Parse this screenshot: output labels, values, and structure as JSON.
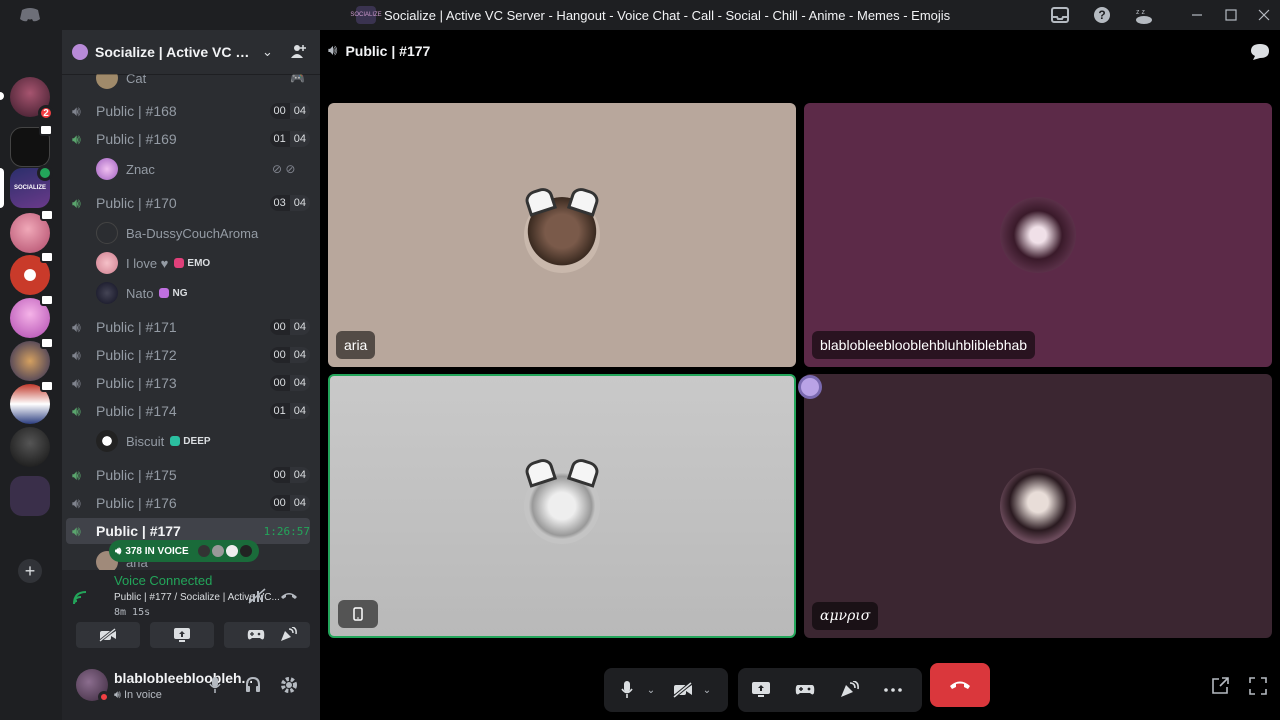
{
  "window": {
    "title": "Socialize | Active VC Server - Hangout - Voice Chat - Call - Social - Chill - Anime - Memes - Emojis",
    "server_icon_text": "SOCIALIZE"
  },
  "guilds": {
    "items": [
      {
        "name": "guild-1",
        "color": "#5b2a3c",
        "badge": "2"
      },
      {
        "name": "guild-2",
        "color": "#222222"
      },
      {
        "name": "guild-socialize",
        "color": "#2b2f6b",
        "text": "SOCIALIZE"
      },
      {
        "name": "guild-4",
        "color": "#d77a9a"
      },
      {
        "name": "guild-5",
        "color": "#c93a2a"
      },
      {
        "name": "guild-6",
        "color": "#e07bd0"
      },
      {
        "name": "guild-7",
        "color": "#2a2a55"
      },
      {
        "name": "guild-8",
        "color": "#7a2a2a"
      },
      {
        "name": "guild-9",
        "color": "#2a2a2a"
      },
      {
        "name": "guild-folder",
        "color": "#4a3a5a"
      }
    ],
    "add_label": "+"
  },
  "server": {
    "name": "Socialize | Active VC S..."
  },
  "channels": [
    {
      "label": "Public | #168",
      "count": "00",
      "limit": "04"
    },
    {
      "label": "Public | #169",
      "count": "01",
      "limit": "04"
    },
    {
      "label": "Public | #170",
      "count": "03",
      "limit": "04"
    },
    {
      "label": "Public | #171",
      "count": "00",
      "limit": "04"
    },
    {
      "label": "Public | #172",
      "count": "00",
      "limit": "04"
    },
    {
      "label": "Public | #173",
      "count": "00",
      "limit": "04"
    },
    {
      "label": "Public | #174",
      "count": "01",
      "limit": "04"
    },
    {
      "label": "Public | #175",
      "count": "00",
      "limit": "04"
    },
    {
      "label": "Public | #176",
      "count": "00",
      "limit": "04"
    },
    {
      "label": "Public | #177",
      "timer": "1:26:57"
    }
  ],
  "members": {
    "cat": {
      "name": "Cat"
    },
    "znac": {
      "name": "Znac"
    },
    "ba": {
      "name": "Ba-DussyCouchAroma"
    },
    "ilove": {
      "name": "I love ♥",
      "tag": "EMO"
    },
    "nato": {
      "name": "Nato",
      "tag": "NG"
    },
    "biscuit": {
      "name": "Biscuit",
      "tag": "DEEP"
    },
    "partial": {
      "name": "aria"
    }
  },
  "voice_pill": {
    "label": "378 IN VOICE"
  },
  "voice_connected": {
    "status": "Voice Connected",
    "channel": "Public | #177 / Socialize | Active VC...",
    "elapsed": "8m 15s"
  },
  "user": {
    "name": "blablobleeblooblehbluhbliblebhab",
    "display_name": "blablobleebloobleh...",
    "status": "In voice"
  },
  "stage": {
    "channel": "Public | #177",
    "tiles": [
      {
        "name": "aria"
      },
      {
        "name": "blablobleeblooblehbluhbliblebhab"
      },
      {
        "name": ""
      },
      {
        "name": "αμνρισ"
      }
    ]
  },
  "colors": {
    "accent_green": "#23a55a",
    "hangup_red": "#da373c",
    "notif_red": "#f23f43"
  }
}
